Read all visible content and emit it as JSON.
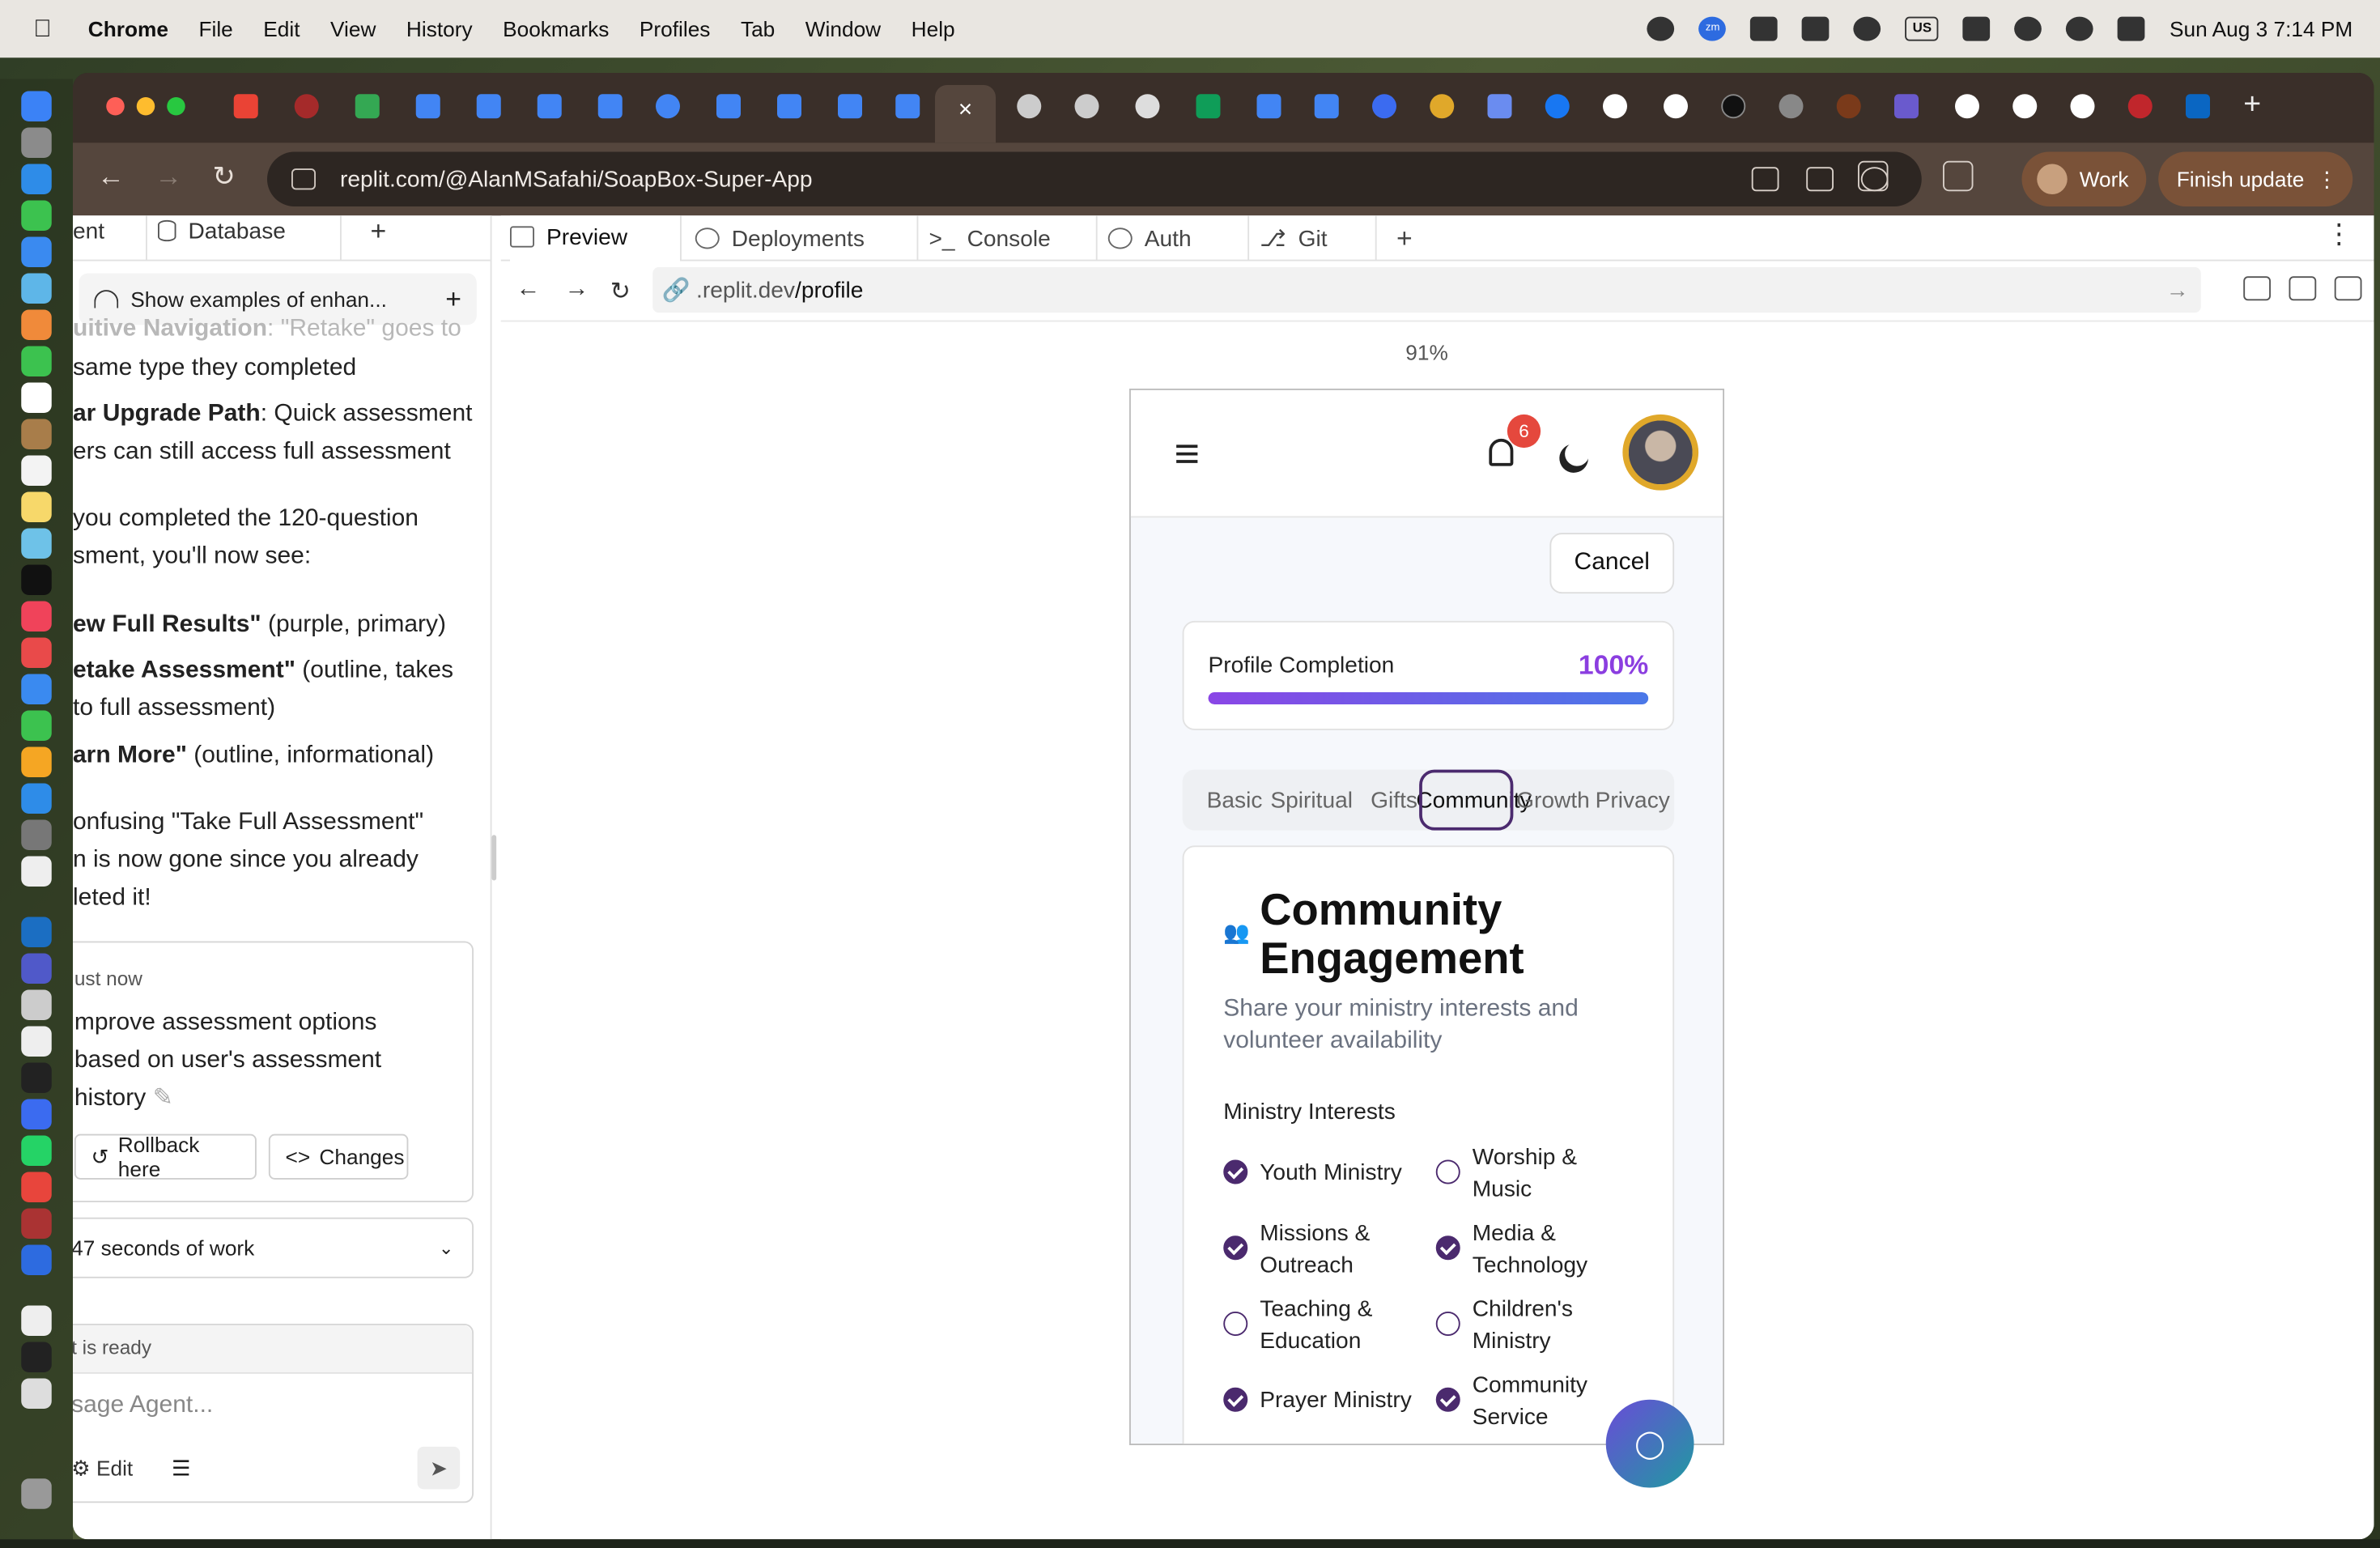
{
  "menubar": {
    "app": "Chrome",
    "items": [
      "File",
      "Edit",
      "View",
      "History",
      "Bookmarks",
      "Profiles",
      "Tab",
      "Window",
      "Help"
    ],
    "datetime": "Sun Aug 3  7:14 PM",
    "input_source": "US",
    "zoom_badge": "zm"
  },
  "browser": {
    "url": "replit.com/@AlanMSafahi/SoapBox-Super-App",
    "profile_label": "Work",
    "update_label": "Finish update",
    "close_tab": "×",
    "new_tab": "+"
  },
  "agent_panel": {
    "tab_agent": "ent",
    "tab_database": "Database",
    "tab_add": "+",
    "show_examples": "Show examples of enhan...",
    "lines": [
      {
        "pre": "uitive Navigation",
        "text": ": \"Retake\" goes to",
        "faded": true
      },
      {
        "text": " same type they completed"
      },
      {
        "bold": "ar Upgrade Path",
        "text": ": Quick assessment"
      },
      {
        "text": "ers can still access full assessment"
      },
      {
        "text": "you completed the 120-question"
      },
      {
        "text": "sment, you'll now see:"
      },
      {
        "bold": "ew Full Results\"",
        "text": " (purple, primary)"
      },
      {
        "bold": "etake Assessment\"",
        "text": " (outline, takes"
      },
      {
        "text": " to full assessment)"
      },
      {
        "bold": "arn More\"",
        "text": " (outline, informational)"
      },
      {
        "text": "onfusing \"Take Full Assessment\""
      },
      {
        "text": "n is now gone since you already"
      },
      {
        "text": "leted it!"
      }
    ],
    "checkpoint_time": "ust now",
    "checkpoint_msg_1": "mprove assessment options",
    "checkpoint_msg_2": "based on user's assessment",
    "checkpoint_msg_3": "history",
    "rollback_label": "Rollback here",
    "changes_label": "Changes",
    "work_summary": "47 seconds of work",
    "status": "t is ready",
    "input_placeholder": "sage Agent...",
    "edit_label": "Edit"
  },
  "workspace": {
    "tabs": [
      "Preview",
      "Deployments",
      "Console",
      "Auth",
      "Git"
    ],
    "add_tab": "+",
    "address_prefix": ".replit.dev",
    "address_path": "/profile",
    "zoom": "91%"
  },
  "app": {
    "notification_count": "6",
    "cancel_label": "Cancel",
    "profile_completion_label": "Profile Completion",
    "profile_completion_value": "100%",
    "profile_completion_fraction": 1.0,
    "tabs": [
      "Basic",
      "Spiritual",
      "Gifts",
      "Community",
      "Growth",
      "Privacy"
    ],
    "active_tab": "Community",
    "section_title": "Community Engagement",
    "section_subtitle": "Share your ministry interests and volunteer availability",
    "interests_label": "Ministry Interests",
    "interests": [
      {
        "label": "Youth Ministry",
        "checked": true
      },
      {
        "label": "Worship & Music",
        "checked": false
      },
      {
        "label": "Missions & Outreach",
        "checked": true
      },
      {
        "label": "Media & Technology",
        "checked": true
      },
      {
        "label": "Teaching & Education",
        "checked": false
      },
      {
        "label": "Children's Ministry",
        "checked": false
      },
      {
        "label": "Prayer Ministry",
        "checked": true
      },
      {
        "label": "Community Service",
        "checked": true
      }
    ]
  },
  "colors": {
    "accent_purple": "#8b3ee0",
    "check_purple": "#4b2a6e",
    "badge_red": "#e5483d",
    "avatar_ring": "#e0a82a"
  }
}
